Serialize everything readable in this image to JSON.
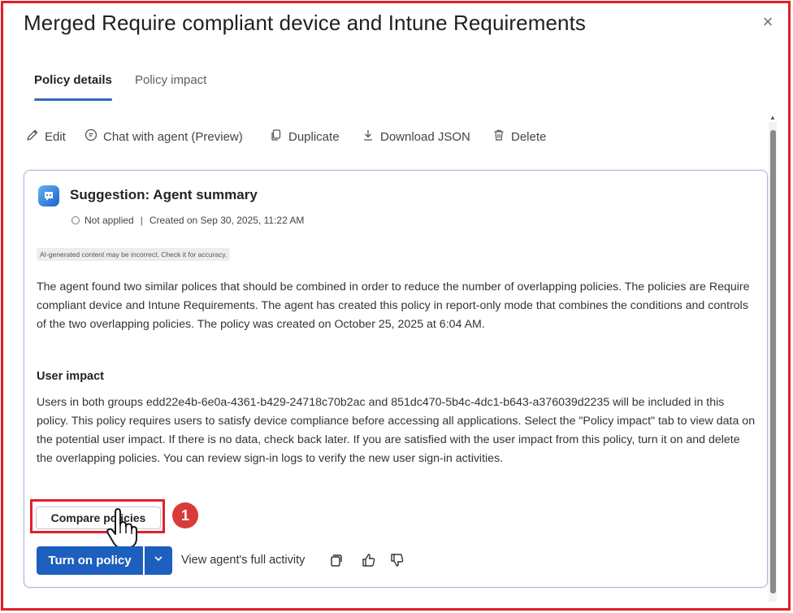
{
  "dialog": {
    "title": "Merged Require compliant device and Intune Requirements",
    "close_glyph": "×"
  },
  "tabs": [
    {
      "label": "Policy details",
      "active": true
    },
    {
      "label": "Policy impact",
      "active": false
    }
  ],
  "toolbar": {
    "edit": "Edit",
    "chat": "Chat with agent (Preview)",
    "duplicate": "Duplicate",
    "download": "Download JSON",
    "delete": "Delete"
  },
  "suggestion": {
    "title": "Suggestion: Agent summary",
    "status": "Not applied",
    "separator": "|",
    "created": "Created on Sep 30, 2025, 11:22 AM",
    "ai_note": "AI-generated content may be incorrect. Check it for accuracy.",
    "summary": "The agent found two similar polices that should be combined in order to reduce the number of overlapping policies. The policies are Require compliant device and Intune Requirements. The agent has created this policy in report-only mode that combines the conditions and controls of the two overlapping policies. The policy was created on October 25, 2025 at 6:04 AM.",
    "user_impact_heading": "User impact",
    "user_impact": "Users in both groups edd22e4b-6e0a-4361-b429-24718c70b2ac and 851dc470-5b4c-4dc1-b643-a376039d2235 will be included in this policy. This policy requires users to satisfy device compliance before accessing all applications. Select the \"Policy impact\" tab to view data on the potential user impact. If there is no data, check back later. If you are satisfied with the user impact from this policy, turn it on and delete the overlapping policies. You can review sign-in logs to verify the new user sign-in activities.",
    "compare_label": "Compare policies",
    "turn_on_label": "Turn on policy",
    "view_activity_label": "View agent's full activity"
  },
  "annotation": {
    "step_number": "1",
    "highlight_color": "#e0202a"
  },
  "colors": {
    "accent": "#1c5fbf",
    "tab_underline": "#2f6ab8",
    "frame": "#e0202a"
  },
  "icons": {
    "edit": "pencil-icon",
    "chat": "chat-icon",
    "duplicate": "copy-icon",
    "download": "download-icon",
    "delete": "trash-icon",
    "agent": "agent-icon",
    "feedback": [
      "copy-feedback-icon",
      "thumbs-up-icon",
      "thumbs-down-icon"
    ]
  }
}
